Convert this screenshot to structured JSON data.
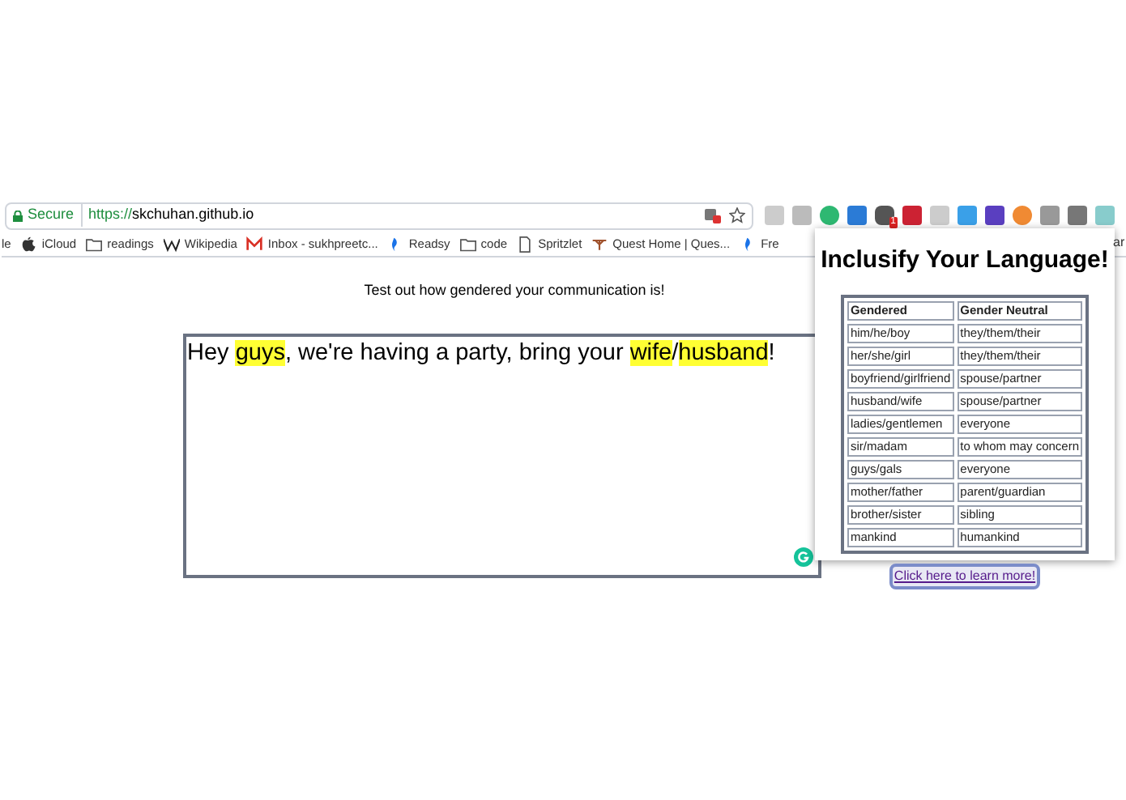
{
  "address_bar": {
    "secure_label": "Secure",
    "scheme": "https://",
    "host": "skchuhan.github.io"
  },
  "extension_badge": "1",
  "bookmarks": [
    {
      "label": "le",
      "kind": "plain"
    },
    {
      "label": "iCloud",
      "kind": "apple"
    },
    {
      "label": "readings",
      "kind": "folder"
    },
    {
      "label": "Wikipedia",
      "kind": "wiki"
    },
    {
      "label": "Inbox - sukhpreetc...",
      "kind": "mail"
    },
    {
      "label": "Readsy",
      "kind": "flag"
    },
    {
      "label": "code",
      "kind": "folder"
    },
    {
      "label": "Spritzlet",
      "kind": "page"
    },
    {
      "label": "Quest Home | Ques...",
      "kind": "quest"
    },
    {
      "label": "Fre",
      "kind": "flag"
    }
  ],
  "bookmarks_overflow": "ar",
  "page": {
    "tagline": "Test out how gendered your communication is!",
    "text_segments": [
      {
        "text": "Hey ",
        "highlighted": false
      },
      {
        "text": "guys",
        "highlighted": true
      },
      {
        "text": ", we're having a party, bring your ",
        "highlighted": false
      },
      {
        "text": "wife",
        "highlighted": true
      },
      {
        "text": "/",
        "highlighted": false
      },
      {
        "text": "husband",
        "highlighted": true
      },
      {
        "text": "!",
        "highlighted": false
      }
    ]
  },
  "popup": {
    "title": "Inclusify Your Language!",
    "table": {
      "columns": [
        "Gendered",
        "Gender Neutral"
      ],
      "rows": [
        [
          "him/he/boy",
          "they/them/their"
        ],
        [
          "her/she/girl",
          "they/them/their"
        ],
        [
          "boyfriend/girlfriend",
          "spouse/partner"
        ],
        [
          "husband/wife",
          "spouse/partner"
        ],
        [
          "ladies/gentlemen",
          "everyone"
        ],
        [
          "sir/madam",
          "to whom may concern"
        ],
        [
          "guys/gals",
          "everyone"
        ],
        [
          "mother/father",
          "parent/guardian"
        ],
        [
          "brother/sister",
          "sibling"
        ],
        [
          "mankind",
          "humankind"
        ]
      ]
    },
    "link": "Click here to learn more!"
  }
}
